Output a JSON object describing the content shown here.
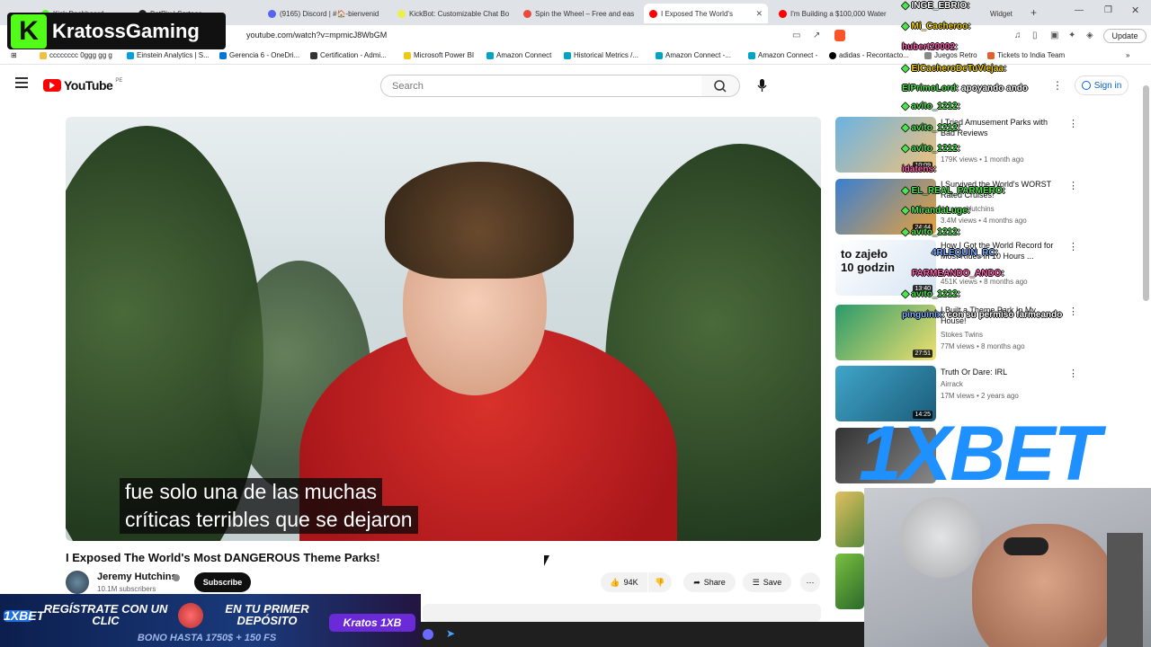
{
  "tabs": [
    {
      "label": "Kick Dashboard",
      "color": "#53fc18"
    },
    {
      "label": "BotRix | Sorteos",
      "color": "#222"
    },
    {
      "label": "(9165) Discord | #🏠-bienvenid",
      "color": "#5865f2"
    },
    {
      "label": "KickBot: Customizable Chat Bo",
      "color": "#e8f04a"
    },
    {
      "label": "Spin the Wheel – Free and eas",
      "color": "#e94b3c"
    },
    {
      "label": "I Exposed The World's",
      "color": "#ff0000"
    },
    {
      "label": "I'm Building a $100,000 Water",
      "color": "#ff0000"
    },
    {
      "label": "Widget",
      "color": "#1aa260"
    }
  ],
  "address": {
    "url": "youtube.com/watch?v=mpmicJ8WbGM",
    "update_label": "Update"
  },
  "bookmarks": [
    {
      "label": "cccccccc 0ggg gg g",
      "color": "#f0c040"
    },
    {
      "label": "Einstein Analytics | S...",
      "color": "#00a1e0"
    },
    {
      "label": "Gerencia 6 - OneDri...",
      "color": "#0078d4"
    },
    {
      "label": "Certification - Admi...",
      "color": "#333"
    },
    {
      "label": "Microsoft Power BI",
      "color": "#f2c811"
    },
    {
      "label": "Amazon Connect",
      "color": "#00a4c4"
    },
    {
      "label": "Historical Metrics /...",
      "color": "#00a4c4"
    },
    {
      "label": "Amazon Connect -...",
      "color": "#00a4c4"
    },
    {
      "label": "Amazon Connect -",
      "color": "#00a4c4"
    },
    {
      "label": "adidas - Recontacto...",
      "color": "#000"
    },
    {
      "label": "Juegos Retro",
      "color": "#888"
    },
    {
      "label": "Tickets to India Team",
      "color": "#e06030"
    }
  ],
  "youtube": {
    "logo": "YouTube",
    "region": "PE",
    "search_placeholder": "Search",
    "signin": "Sign in"
  },
  "video": {
    "captions": [
      "fue solo una de las muchas",
      "críticas terribles que se dejaron"
    ],
    "title": "I Exposed The World's Most DANGEROUS Theme Parks!",
    "channel": "Jeremy Hutchins",
    "subscribers": "10.1M subscribers",
    "subscribe": "Subscribe",
    "likes": "94K",
    "share": "Share",
    "save": "Save"
  },
  "related": [
    {
      "title": "I Tried Amusement Parks with Bad Reviews",
      "meta1": "179K views • 1 month ago",
      "duration": "10:09"
    },
    {
      "title": "I Survived the World's WORST Rated Cruises!",
      "meta1": "3.4M views • 4 months ago",
      "channel": "Jeremy Hutchins",
      "duration": "24:44"
    },
    {
      "title": "How I Got the World Record for Most Rides in 10 Hours ...",
      "meta1": "451K views • 8 months ago",
      "channel": "Jeremy Hutchins",
      "duration": "13:40"
    },
    {
      "title": "I Built a Theme Park In My House!",
      "channel": "Stokes Twins",
      "meta1": "77M views • 8 months ago",
      "duration": "27:51"
    },
    {
      "title": "Truth Or Dare: IRL",
      "channel": "Airrack",
      "meta1": "17M views • 2 years ago",
      "duration": "14:25"
    }
  ],
  "chat": [
    {
      "user": "INGE_EBRIO",
      "msg": ":"
    },
    {
      "user": "Mi_Cacheroo",
      "msg": ":"
    },
    {
      "user": "hubert20002",
      "msg": ":"
    },
    {
      "user": "ElCacheroDeTuViejaa",
      "msg": ":"
    },
    {
      "user": "ElPrimoLord",
      "msg": ": apoyando ando"
    },
    {
      "user": "avito_1212",
      "msg": ":"
    },
    {
      "user": "avito_1212",
      "msg": ":"
    },
    {
      "user": "avito_1212",
      "msg": ":"
    },
    {
      "user": "idatens",
      "msg": ":"
    },
    {
      "user": "EL_REAL_FARMERO",
      "msg": ":"
    },
    {
      "user": "MirandaLuge",
      "msg": ":"
    },
    {
      "user": "avito_1212",
      "msg": ":"
    },
    {
      "user": "4RLEQUIN_RC",
      "msg": ":"
    },
    {
      "user": "FARMEANDO_ANDO",
      "msg": ":"
    },
    {
      "user": "avito_1212",
      "msg": ":"
    },
    {
      "user": "pinguinix",
      "msg": ": con su permiso farmeando"
    }
  ],
  "overlay": {
    "brand": "KratossGaming",
    "brand_letter": "K",
    "bet": "1XBET",
    "promo_left": "REGÍSTRATE CON UN CLIC",
    "promo_mid": "EN TU PRIMER DEPÓSITO",
    "promo_code": "Kratos 1XB",
    "promo_bottom": "BONO HASTA 1750$ + 150 FS",
    "promo_logo": "1XBET"
  }
}
